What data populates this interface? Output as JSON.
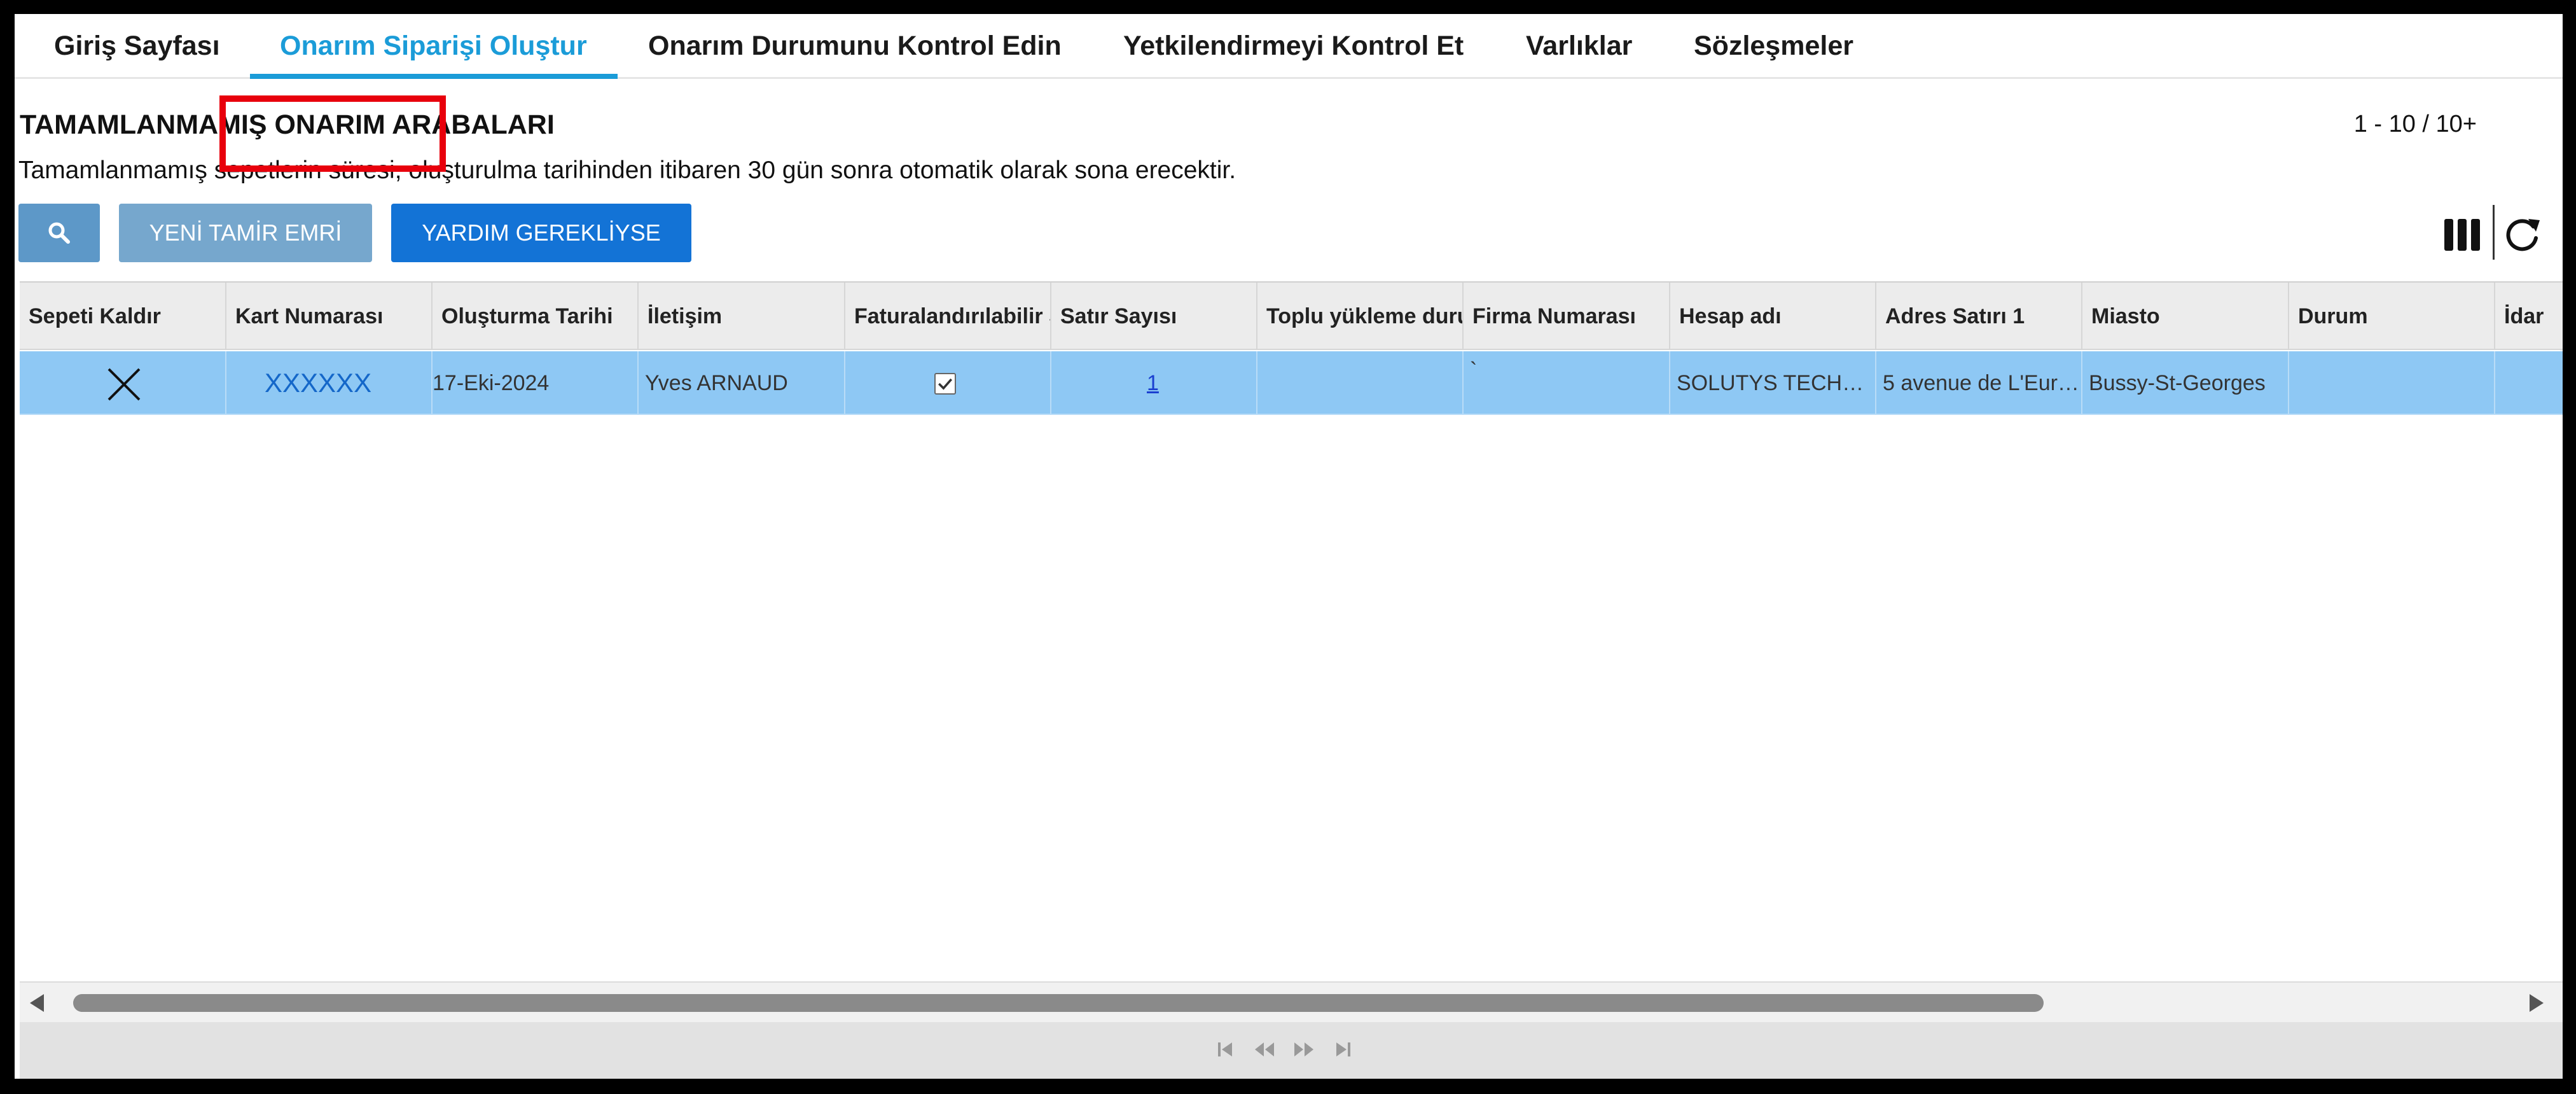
{
  "nav": {
    "tabs": [
      {
        "label": "Giriş Sayfası"
      },
      {
        "label": "Onarım Siparişi Oluştur"
      },
      {
        "label": "Onarım Durumunu Kontrol Edin"
      },
      {
        "label": "Yetkilendirmeyi Kontrol Et"
      },
      {
        "label": "Varlıklar"
      },
      {
        "label": "Sözleşmeler"
      }
    ],
    "active_tab": "Onarım Siparişi Oluştur"
  },
  "page": {
    "title": "TAMAMLANMAMIŞ ONARIM ARABALARI",
    "pager_text": "1 - 10 / 10+",
    "expiry_note": "Tamamlanmamış sepetlerin süresi, oluşturulma tarihinden itibaren 30 gün sonra otomatik olarak sona erecektir."
  },
  "toolbar": {
    "search_icon": "search-icon",
    "new_repair_label": "YENİ TAMİR EMRİ",
    "help_label": "YARDIM GEREKLİYSE",
    "columns_icon": "columns-icon",
    "refresh_icon": "refresh-icon"
  },
  "table": {
    "headers": [
      "Sepeti Kaldır",
      "Kart Numarası",
      "Oluşturma Tarihi",
      "İletişim",
      "Faturalandırılabilir S",
      "Satır Sayısı",
      "Toplu yükleme duru",
      "Firma Numarası",
      "Hesap adı",
      "Adres Satırı 1",
      "Miasto",
      "Durum",
      "İdar"
    ],
    "rows": [
      {
        "remove_icon": "close-icon",
        "card_number": "XXXXXX",
        "created_date": "17-Eki-2024",
        "contact": "Yves ARNAUD",
        "billable": true,
        "line_count": "1",
        "bulk_upload_status": "",
        "company_number": "`",
        "account_name": "SOLUTYS TECH…",
        "address_line_1": "5 avenue de L'Eur…",
        "city": "Bussy-St-Georges",
        "status": "",
        "admin": ""
      }
    ]
  },
  "colors": {
    "accent": "#1b9cd8",
    "selected_row": "#8ec8f4",
    "primary_button": "#1373d6",
    "highlight_box": "#e8000c"
  }
}
